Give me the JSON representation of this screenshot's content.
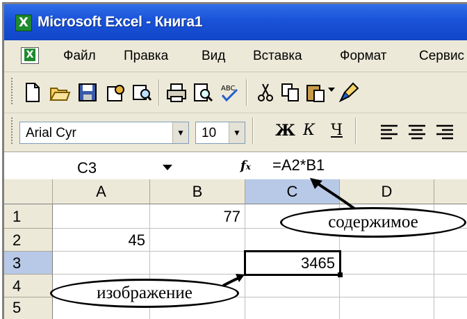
{
  "window": {
    "title": "Microsoft Excel - Книга1",
    "app_icon": "excel-icon"
  },
  "menu": {
    "items": [
      "Файл",
      "Правка",
      "Вид",
      "Вставка",
      "Формат",
      "Сервис"
    ]
  },
  "toolbar_standard": {
    "icons": [
      "new-icon",
      "open-icon",
      "save-icon",
      "permission-icon",
      "research-icon",
      "print-icon",
      "print-preview-icon",
      "spelling-icon",
      "cut-icon",
      "copy-icon",
      "paste-icon",
      "format-painter-icon"
    ]
  },
  "toolbar_format": {
    "font_name": "Arial Cyr",
    "font_size": "10",
    "bold": "Ж",
    "italic": "К",
    "underline": "Ч"
  },
  "formula_bar": {
    "name_box": "C3",
    "fx": "fx",
    "formula": "=A2*B1"
  },
  "sheet": {
    "columns": [
      "A",
      "B",
      "C",
      "D"
    ],
    "rows": [
      "1",
      "2",
      "3",
      "4",
      "5"
    ],
    "cells": {
      "B1": "77",
      "A2": "45",
      "C3": "3465"
    },
    "active_cell": "C3"
  },
  "annotations": {
    "content_label": "содержимое",
    "display_label": "изображение"
  },
  "colors": {
    "title_bar": "#1a52d8",
    "chrome": "#ece9d8",
    "selected_header": "#b8c9e8"
  }
}
